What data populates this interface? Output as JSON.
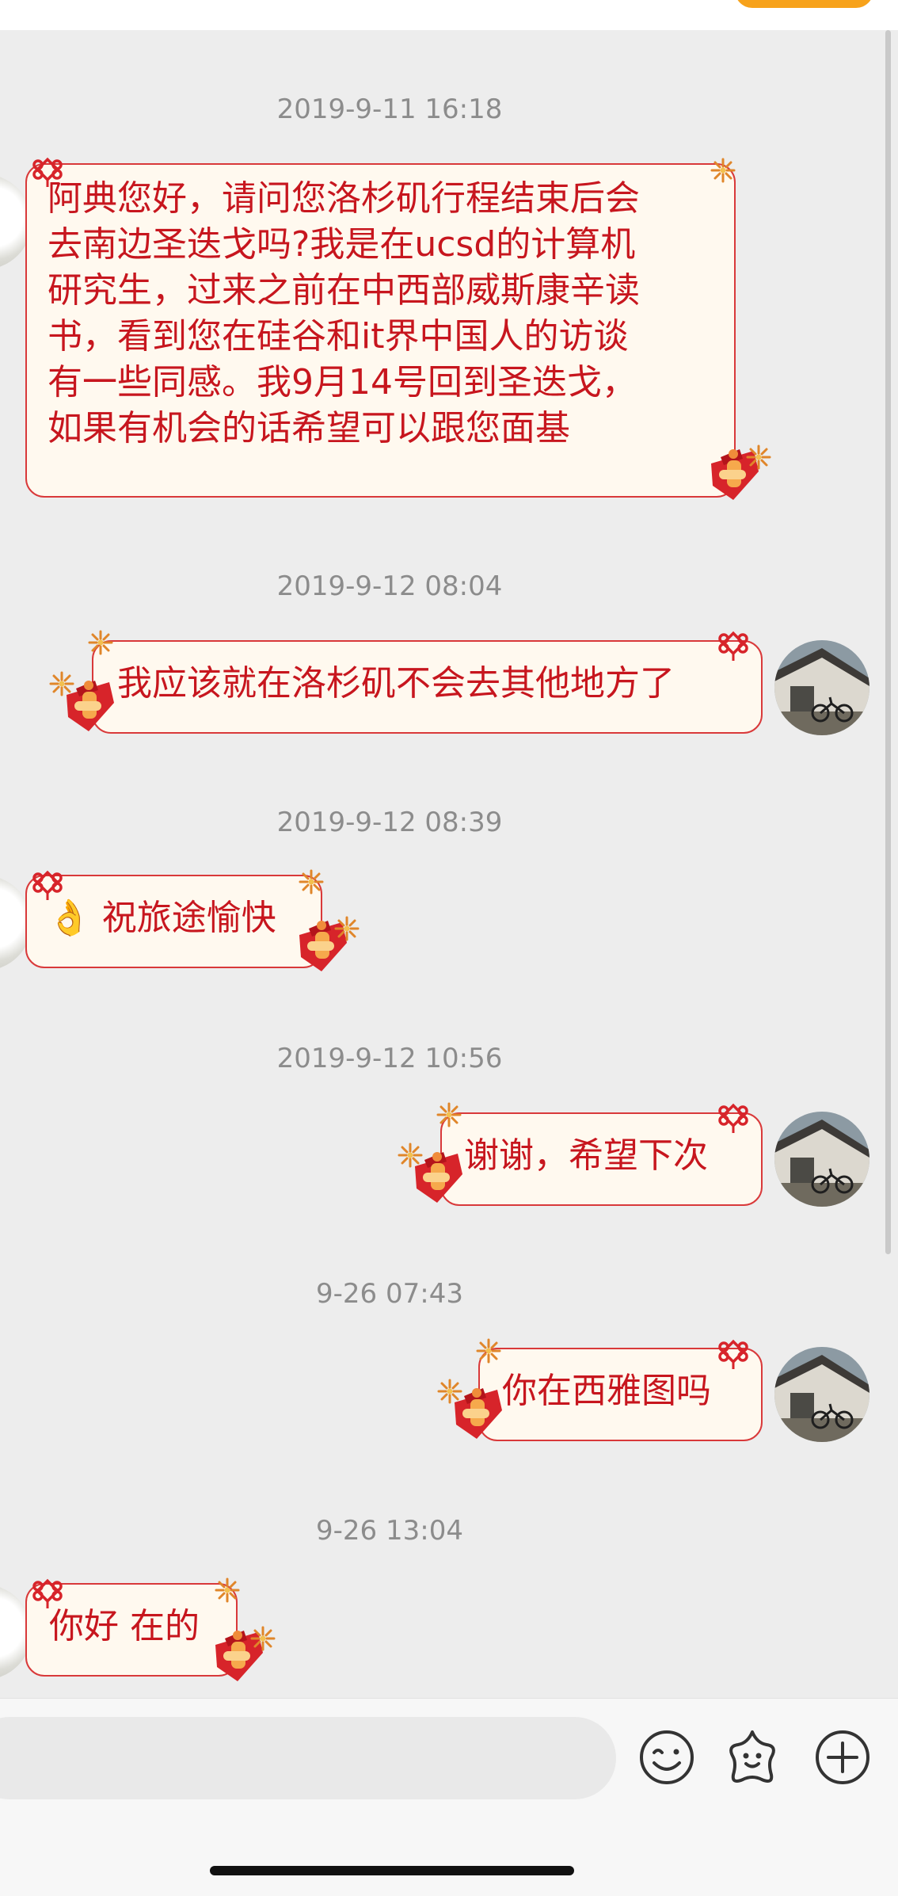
{
  "chat": {
    "messages": [
      {
        "timestamp": "2019-9-11 16:18",
        "side": "left",
        "lines": [
          "阿典您好，请问您洛杉矶行程结束后会",
          "去南边圣迭戈吗?我是在ucsd的计算机",
          "研究生，过来之前在中西部威斯康辛读",
          "书，看到您在硅谷和it界中国人的访谈",
          "有一些同感。我9月14号回到圣迭戈，",
          "如果有机会的话希望可以跟您面基"
        ]
      },
      {
        "timestamp": "2019-9-12 08:04",
        "side": "right",
        "lines": [
          "我应该就在洛杉矶不会去其他地方了"
        ]
      },
      {
        "timestamp": "2019-9-12 08:39",
        "side": "left",
        "emoji": "👌",
        "lines": [
          "祝旅途愉快"
        ]
      },
      {
        "timestamp": "2019-9-12 10:56",
        "side": "right",
        "lines": [
          "谢谢，希望下次"
        ]
      },
      {
        "timestamp": "9-26 07:43",
        "side": "right",
        "lines": [
          "你在西雅图吗"
        ]
      },
      {
        "timestamp": "9-26 13:04",
        "side": "left",
        "lines": [
          "你好 在的"
        ]
      }
    ]
  },
  "input": {
    "value": "",
    "placeholder": ""
  },
  "toolbar": {
    "icons": [
      "smiley-face-icon",
      "sticker-star-icon",
      "plus-circle-icon"
    ]
  },
  "colors": {
    "background": "#ededed",
    "bubble_fill": "#fff9ef",
    "bubble_border": "#d9393a",
    "bubble_text": "#c7161e",
    "timestamp_text": "#8c8c8c",
    "accent": "#f7a21b"
  }
}
